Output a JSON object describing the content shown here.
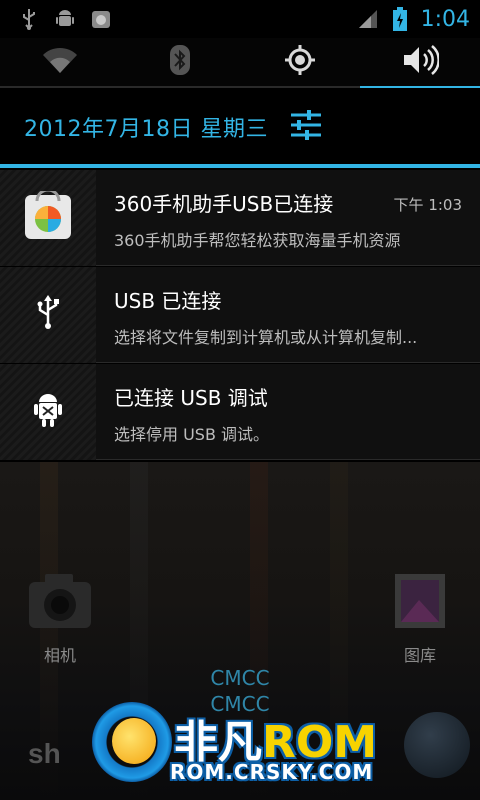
{
  "status_bar": {
    "time": "1:04",
    "left_icons": [
      "usb-icon",
      "android-debug-icon",
      "app-store-icon"
    ],
    "right_icons": [
      "signal-icon",
      "battery-charging-icon"
    ]
  },
  "quick_toggles": [
    {
      "name": "wifi-toggle",
      "icon": "wifi-icon",
      "active": false
    },
    {
      "name": "bluetooth-toggle",
      "icon": "bluetooth-icon",
      "active": false
    },
    {
      "name": "gps-toggle",
      "icon": "gps-icon",
      "active": false
    },
    {
      "name": "sound-toggle",
      "icon": "volume-icon",
      "active": true
    }
  ],
  "date": "2012年7月18日 星期三",
  "notifications": [
    {
      "title": "360手机助手USB已连接",
      "subtitle": "360手机助手帮您轻松获取海量手机资源",
      "time": "下午 1:03",
      "icon": "app-store-icon"
    },
    {
      "title": "USB 已连接",
      "subtitle": "选择将文件复制到计算机或从计算机复制...",
      "time": "",
      "icon": "usb-icon"
    },
    {
      "title": "已连接 USB 调试",
      "subtitle": "选择停用 USB 调试。",
      "time": "",
      "icon": "android-debug-icon"
    }
  ],
  "home": {
    "apps": [
      {
        "label": "相机",
        "icon": "camera-icon"
      },
      {
        "label": "图库",
        "icon": "gallery-icon"
      }
    ],
    "carrier_lines": [
      "CMCC",
      "CMCC"
    ],
    "dock_left_text": "sh"
  },
  "watermark": {
    "title_cn": "非凡",
    "title_rom": "ROM",
    "url": "ROM.CRSKY.COM"
  },
  "colors": {
    "accent": "#33b5e5",
    "background": "#000000",
    "notification_bg": "#101010",
    "secondary_text": "#bdbdbd"
  }
}
